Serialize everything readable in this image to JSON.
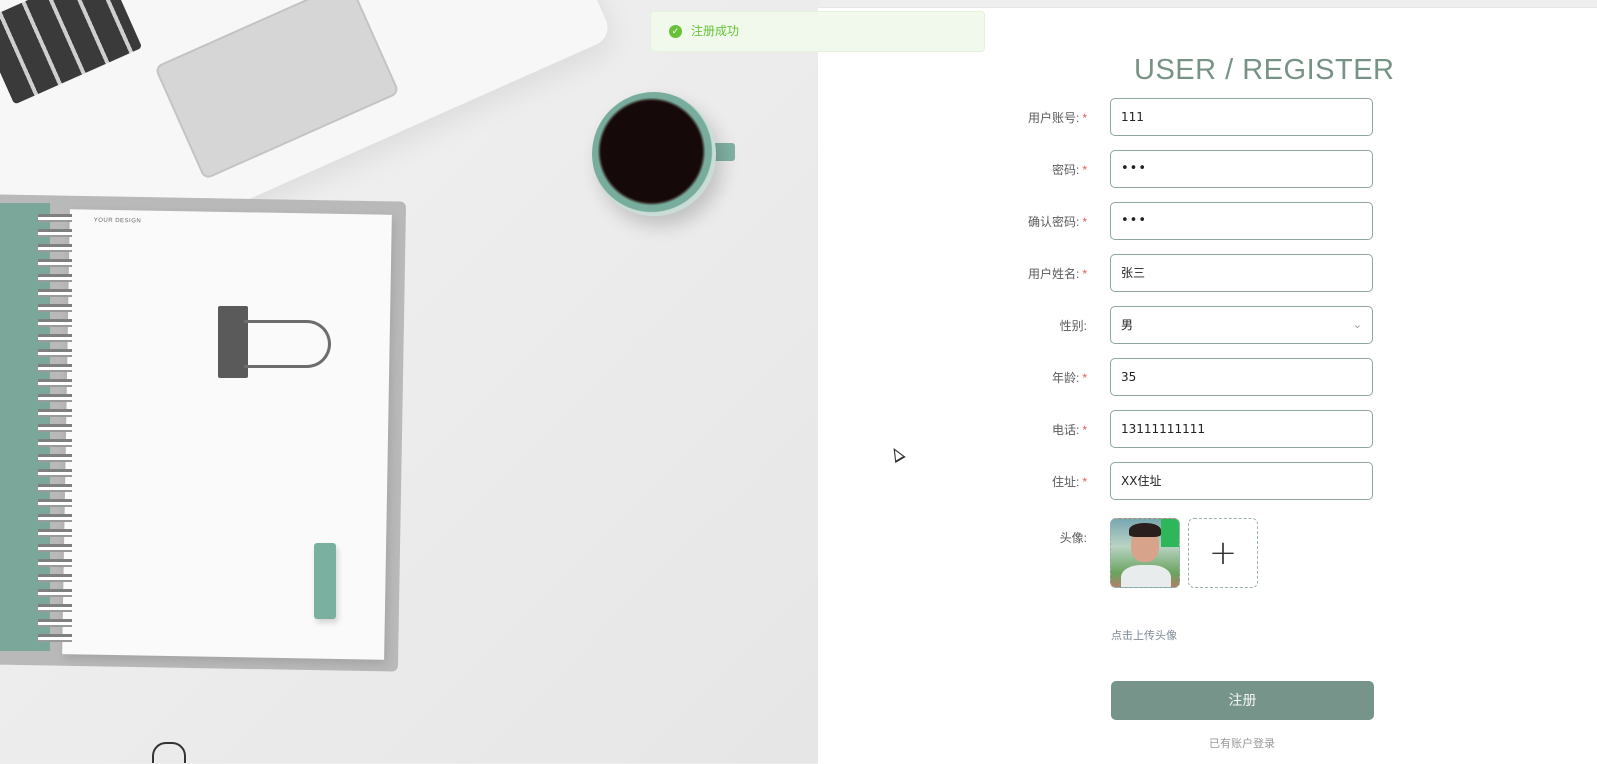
{
  "toast": {
    "message": "注册成功",
    "icon": "check-circle-icon",
    "color": "#67c23a"
  },
  "form": {
    "title": "USER / REGISTER",
    "fields": [
      {
        "key": "username",
        "label": "用户账号:",
        "required": true,
        "value": "111"
      },
      {
        "key": "password",
        "label": "密码:",
        "required": true,
        "value": "•••"
      },
      {
        "key": "confirm_password",
        "label": "确认密码:",
        "required": true,
        "value": "•••"
      },
      {
        "key": "name",
        "label": "用户姓名:",
        "required": true,
        "value": "张三"
      },
      {
        "key": "gender",
        "label": "性别:",
        "required": false,
        "value": "男"
      },
      {
        "key": "age",
        "label": "年龄:",
        "required": true,
        "value": "35"
      },
      {
        "key": "phone",
        "label": "电话:",
        "required": true,
        "value": "13111111111"
      },
      {
        "key": "address",
        "label": "住址:",
        "required": true,
        "value": "XX住址"
      }
    ],
    "required_mark": "*",
    "avatar_label": "头像:",
    "upload_hint": "点击上传头像",
    "upload_icon": "plus-icon",
    "submit_label": "注册",
    "login_link": "已有账户登录"
  },
  "colors": {
    "accent": "#76948a",
    "title": "#779386",
    "border": "#8fa79c"
  }
}
